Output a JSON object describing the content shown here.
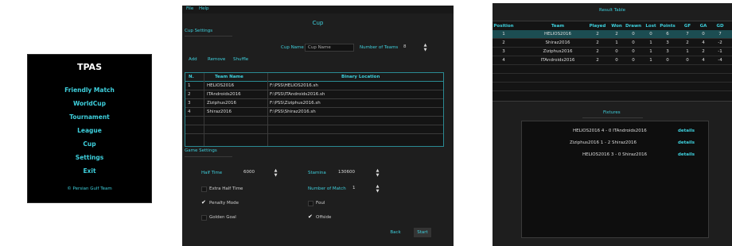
{
  "main_menu": {
    "title": "TPAS",
    "items": [
      "Friendly Match",
      "WorldCup",
      "Tournament",
      "League",
      "Cup",
      "Settings",
      "Exit"
    ],
    "footer": "© Persian Gulf Team"
  },
  "cup_window": {
    "menu": [
      "File",
      "Help"
    ],
    "title": "Cup",
    "cup_settings_label": "Cup Settings",
    "cup_name_label": "Cup Name",
    "cup_name_placeholder": "Cup Name",
    "num_teams_label": "Number of Teams",
    "num_teams_value": "8",
    "actions": [
      "Add",
      "Remove",
      "Shuffle"
    ],
    "team_table": {
      "headers": [
        "N.",
        "Team Name",
        "Binary Location"
      ],
      "rows": [
        [
          "1",
          "HELIOS2016",
          "F:\\PSS\\HELIOS2016.sh"
        ],
        [
          "2",
          "ITAndroids2016",
          "F:\\PSS\\ITAndroids2016.sh"
        ],
        [
          "3",
          "Ziziphus2016",
          "F:\\PSS\\Ziziphus2016.sh"
        ],
        [
          "4",
          "Shiraz2016",
          "F:\\PSS\\Shiraz2016.sh"
        ]
      ]
    },
    "game_settings_label": "Game Settings",
    "half_time_label": "Half Time",
    "half_time_value": "6000",
    "stamina_label": "Stamina",
    "stamina_value": "130600",
    "number_of_match_label": "Number of Match",
    "number_of_match_value": "1",
    "checkboxes": {
      "extra_half_time": {
        "label": "Extra Half Time",
        "checked": false
      },
      "foul": {
        "label": "Foul",
        "checked": false
      },
      "penalty_mode": {
        "label": "Penalty Mode",
        "checked": true
      },
      "offside": {
        "label": "Offside",
        "checked": true
      },
      "golden_goal": {
        "label": "Golden Goal",
        "checked": false
      }
    },
    "back_label": "Back",
    "start_label": "Start"
  },
  "result_window": {
    "title": "Result Table",
    "headers": [
      "Position",
      "Team",
      "Played",
      "Won",
      "Drawn",
      "Lost",
      "Points",
      "GF",
      "GA",
      "GD"
    ],
    "rows": [
      [
        "1",
        "HELIOS2016",
        "2",
        "2",
        "0",
        "0",
        "6",
        "7",
        "0",
        "7"
      ],
      [
        "2",
        "Shiraz2016",
        "2",
        "1",
        "0",
        "1",
        "3",
        "2",
        "4",
        "-2"
      ],
      [
        "3",
        "Ziziphus2016",
        "2",
        "0",
        "0",
        "1",
        "3",
        "1",
        "2",
        "-1"
      ],
      [
        "4",
        "ITAndroids2016",
        "2",
        "0",
        "0",
        "1",
        "0",
        "0",
        "4",
        "-4"
      ]
    ],
    "fixtures_label": "Fixtures",
    "fixtures": [
      {
        "text": "HELIOS2016 4 - 0 ITAndroids2016",
        "link": "details"
      },
      {
        "text": "Ziziphus2016 1 - 2 Shiraz2016",
        "link": "details"
      },
      {
        "text": "HELIOS2016 3 - 0 Shiraz2016",
        "link": "details"
      }
    ]
  },
  "colors": {
    "accent": "#3ed0dd",
    "panel": "#1e1e1e",
    "background": "#ffffff"
  }
}
